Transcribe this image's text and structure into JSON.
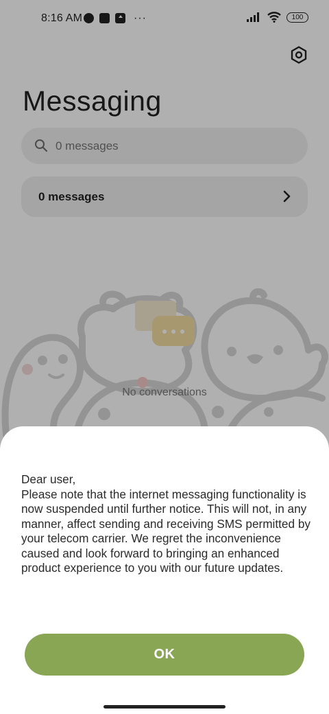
{
  "status_bar": {
    "time": "8:16 AM",
    "battery": "100",
    "notification_icons": [
      "moon-icon",
      "square-app-icon",
      "upload-icon"
    ],
    "overflow": "···"
  },
  "header": {
    "title": "Messaging",
    "settings_icon": "gear-icon"
  },
  "search": {
    "placeholder": "0 messages",
    "icon": "search-icon"
  },
  "messages_row": {
    "label": "0 messages",
    "icon": "chevron-right-icon"
  },
  "empty_state": {
    "text": "No conversations"
  },
  "dialog": {
    "message": "Dear user,\nPlease note that the internet messaging functionality is now suspended until further notice. This will not, in any manner, affect sending and receiving SMS permitted by your telecom carrier. We regret the inconvenience caused and look forward to bringing an enhanced product experience to you with our future updates.",
    "ok_label": "OK",
    "button_color": "#88a654"
  }
}
